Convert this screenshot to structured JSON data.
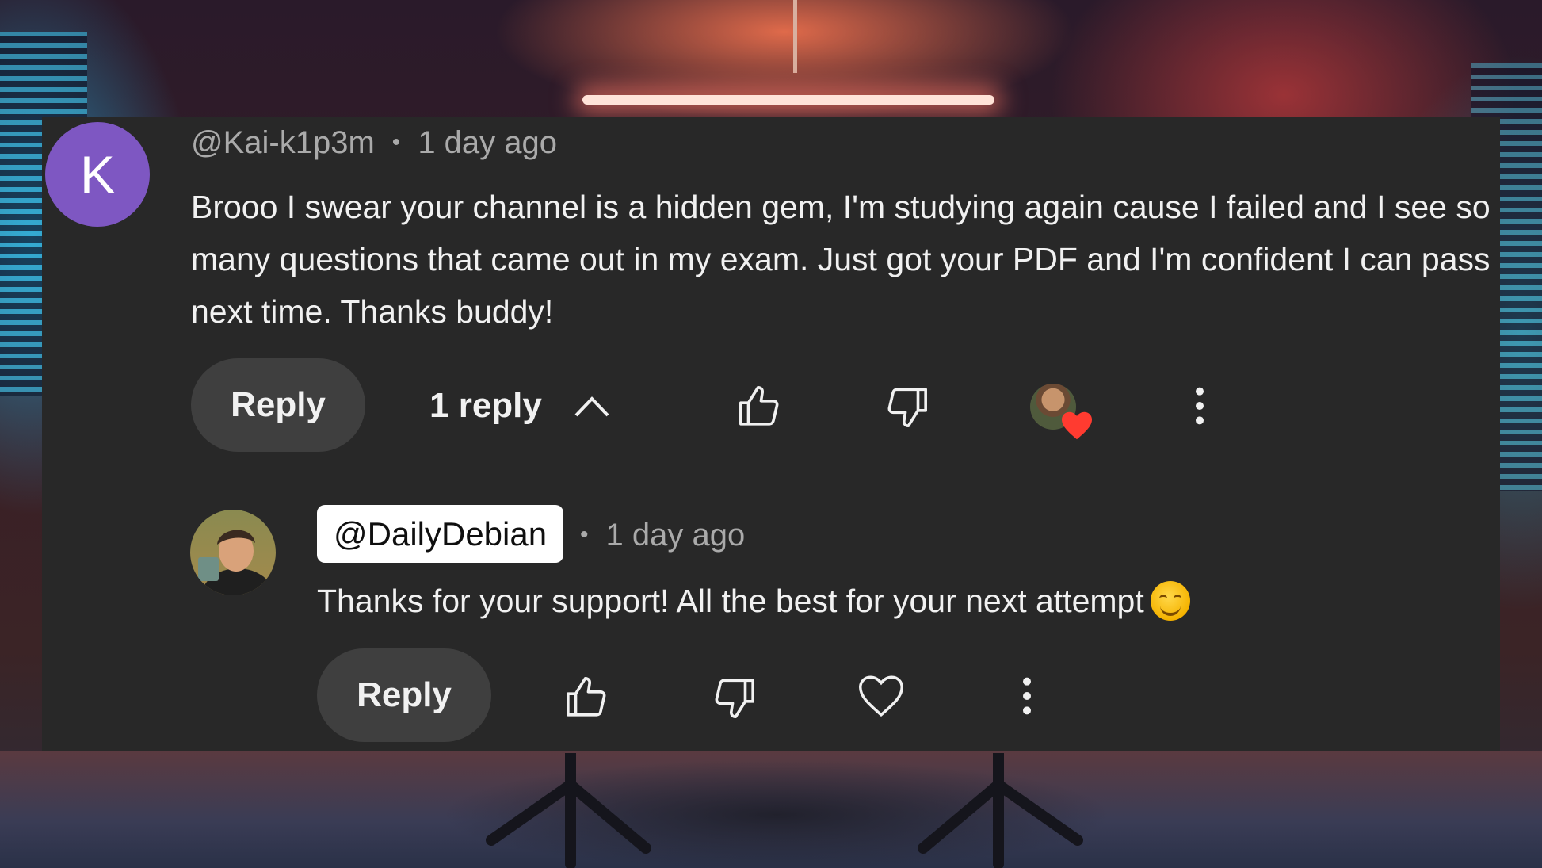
{
  "comment": {
    "avatar_letter": "K",
    "author": "@Kai-k1p3m",
    "separator": "•",
    "time": "1 day ago",
    "text": "Brooo I swear your channel is a hidden gem, I'm studying again cause I failed and I see so many questions that came out in my exam. Just got your PDF and I'm confident I can pass next time. Thanks buddy!",
    "reply_label": "Reply",
    "replies_count_label": "1 reply",
    "avatar_color": "#7e57c2",
    "hearted_by_creator": true
  },
  "reply": {
    "author": "@DailyDebian",
    "separator": "•",
    "time": "1 day ago",
    "text": "Thanks for your support! All the best for your next attempt",
    "emoji": "☺",
    "reply_label": "Reply"
  },
  "icons": {
    "like": "thumbs-up-icon",
    "dislike": "thumbs-down-icon",
    "more": "more-vertical-icon",
    "collapse": "chevron-up-icon",
    "heart": "heart-icon",
    "creator_heart": "creator-heart-badge"
  },
  "colors": {
    "panel": "#282828",
    "pill": "#3f3f3f",
    "heart_badge": "#ff3b30",
    "meta_text": "#aaaaaa"
  }
}
